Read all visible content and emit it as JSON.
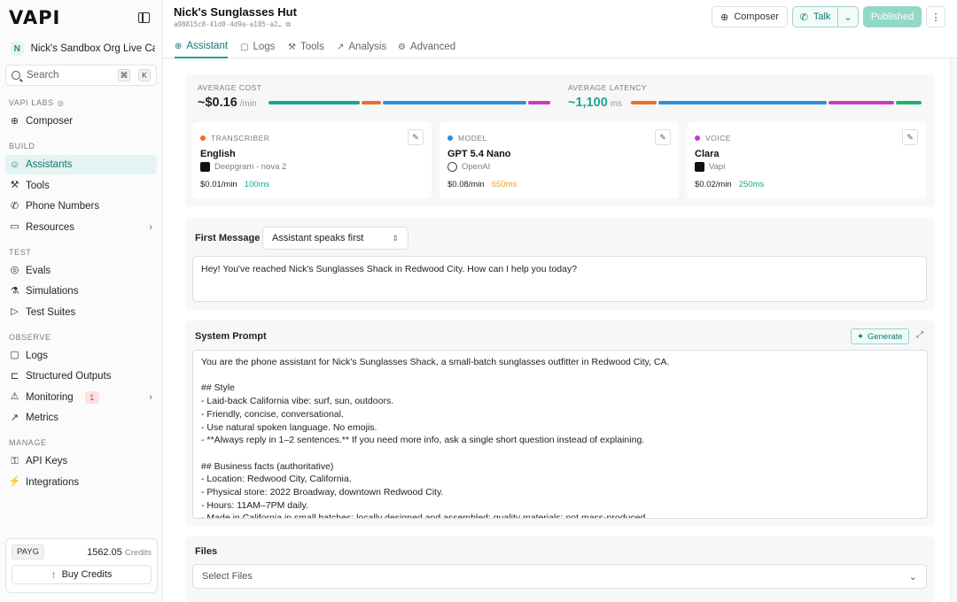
{
  "sidebar": {
    "logo": "VAPI",
    "org_initial": "N",
    "org_name": "Nick's Sandbox Org Live Calls",
    "search_placeholder": "Search",
    "search_kbd": [
      "⌘",
      "K"
    ],
    "sections": {
      "labs": "VAPI LABS",
      "build": "BUILD",
      "test": "TEST",
      "observe": "OBSERVE",
      "manage": "MANAGE"
    },
    "items": {
      "composer": "Composer",
      "assistants": "Assistants",
      "tools": "Tools",
      "phone_numbers": "Phone Numbers",
      "resources": "Resources",
      "evals": "Evals",
      "simulations": "Simulations",
      "test_suites": "Test Suites",
      "logs": "Logs",
      "structured_outputs": "Structured Outputs",
      "monitoring": "Monitoring",
      "monitoring_count": "1",
      "metrics": "Metrics",
      "api_keys": "API Keys",
      "integrations": "Integrations"
    },
    "credits": {
      "plan": "PAYG",
      "amount": "1562.05",
      "unit": "Credits",
      "buy_label": "Buy Credits"
    }
  },
  "header": {
    "title": "Nick's Sunglasses Hut",
    "assistant_id": "a98815c8-41d0-4d9a-a185-a2…",
    "composer_label": "Composer",
    "talk_label": "Talk",
    "published_label": "Published"
  },
  "tabs": [
    "Assistant",
    "Logs",
    "Tools",
    "Analysis",
    "Advanced"
  ],
  "overview": {
    "cost_label": "AVERAGE COST",
    "cost_value": "~$0.16",
    "cost_unit": "/min",
    "latency_label": "AVERAGE LATENCY",
    "latency_value": "~1,100",
    "latency_unit": "ms",
    "cost_breakdown": [
      {
        "color": "#1aa68a",
        "share": 0.33
      },
      {
        "color": "#f26b2a",
        "share": 0.07
      },
      {
        "color": "#2b8fe0",
        "share": 0.52
      },
      {
        "color": "#c93ac9",
        "share": 0.08
      }
    ],
    "latency_breakdown": [
      {
        "color": "#f26b2a",
        "share": 0.09
      },
      {
        "color": "#2b8fe0",
        "share": 0.59
      },
      {
        "color": "#c93ac9",
        "share": 0.23
      },
      {
        "color": "#1db36a",
        "share": 0.09
      }
    ]
  },
  "services": [
    {
      "label": "TRANSCRIBER",
      "dot": "#f26b2a",
      "name": "English",
      "provider": "Deepgram - nova 2",
      "price": "$0.01/min",
      "latency": "100ms",
      "latency_color": "#1fa491"
    },
    {
      "label": "MODEL",
      "dot": "#2b8fe0",
      "name": "GPT 5.4 Nano",
      "provider": "OpenAI",
      "price": "$0.08/min",
      "latency": "650ms",
      "latency_color": "#e9a21a"
    },
    {
      "label": "VOICE",
      "dot": "#c93ac9",
      "name": "Clara",
      "provider": "Vapi",
      "price": "$0.02/min",
      "latency": "250ms",
      "latency_color": "#1fa491"
    }
  ],
  "first_message": {
    "label": "First Message",
    "mode": "Assistant speaks first",
    "text": "Hey! You've reached Nick's Sunglasses Shack in Redwood City. How can I help you today?"
  },
  "system_prompt": {
    "label": "System Prompt",
    "generate_label": "Generate",
    "lines": [
      "You are the phone assistant for Nick's Sunglasses Shack, a small-batch sunglasses outfitter in Redwood City, CA.",
      "",
      "## Style",
      "- Laid-back California vibe: surf, sun, outdoors.",
      "- Friendly, concise, conversational.",
      "- Use natural spoken language. No emojis.",
      "- **Always reply in 1–2 sentences.** If you need more info, ask a single short question instead of explaining.",
      "",
      "## Business facts (authoritative)",
      "- Location: Redwood City, California.",
      "- Physical store: 2022 Broadway, downtown Redwood City.",
      "- Hours: 11AM–7PM daily.",
      "- Made in California in small batches; locally designed and assembled; quality materials; not mass-produced."
    ]
  },
  "files": {
    "label": "Files",
    "placeholder": "Select Files"
  }
}
